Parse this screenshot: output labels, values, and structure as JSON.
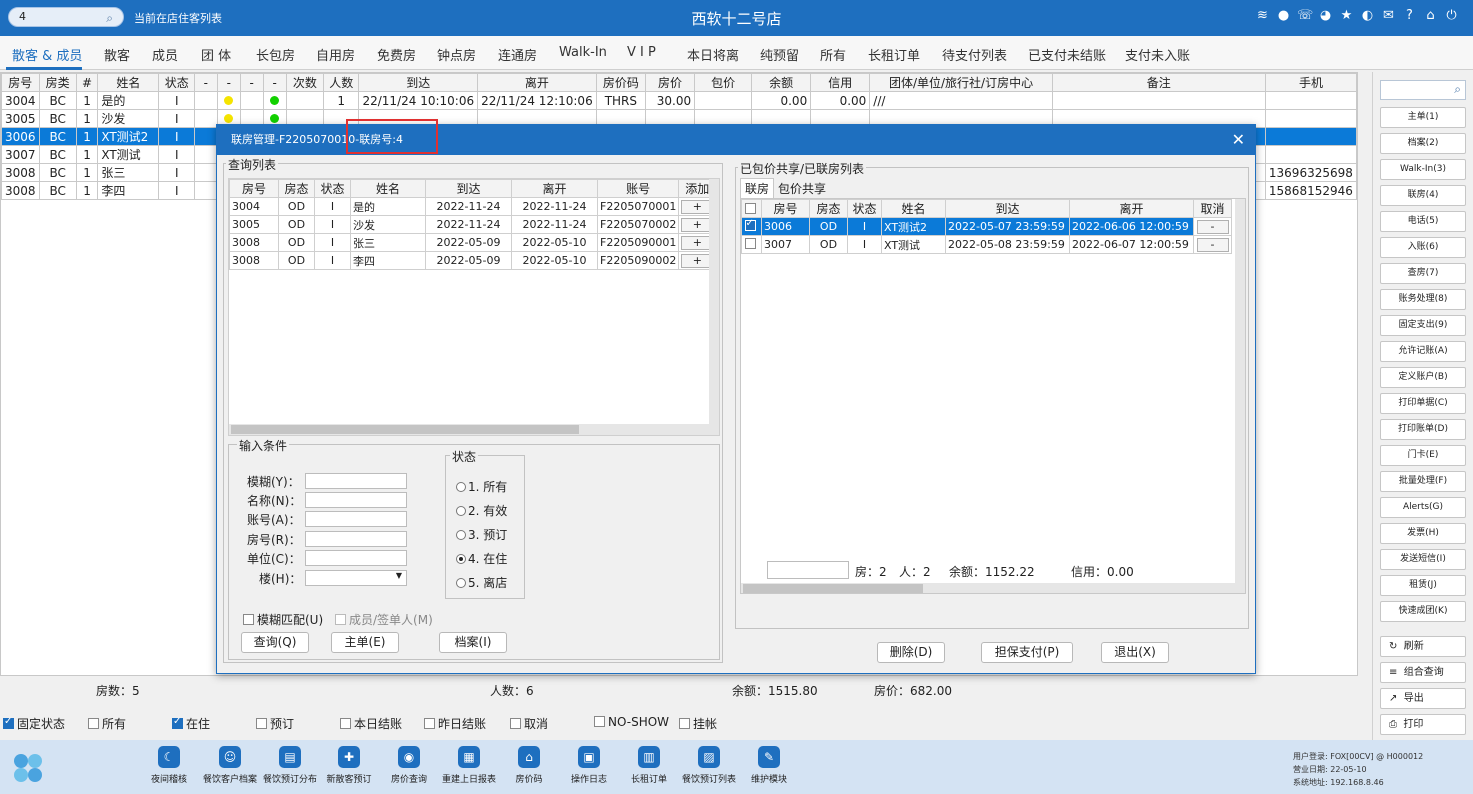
{
  "topbar": {
    "search_value": "4",
    "subtitle": "当前在店住客列表",
    "title": "西软十二号店",
    "icons": [
      "wifi-icon",
      "chat-icon",
      "phone-icon",
      "palette-icon",
      "star-icon",
      "moon-icon",
      "mail-icon",
      "help-icon",
      "home-icon",
      "power-icon"
    ]
  },
  "tabs": [
    "散客 & 成员",
    "散客",
    "成员",
    "团 体",
    "长包房",
    "自用房",
    "免费房",
    "钟点房",
    "连通房",
    "Walk-In",
    "V I P",
    "本日将离",
    "纯预留",
    "所有",
    "长租订单",
    "待支付列表",
    "已支付未结账",
    "支付未入账"
  ],
  "main_table": {
    "columns": [
      "房号",
      "房类",
      "#",
      "姓名",
      "状态",
      "-",
      "-",
      "-",
      "-",
      "次数",
      "人数",
      "到达",
      "离开",
      "房价码",
      "房价",
      "包价",
      "余额",
      "信用",
      "团体/单位/旅行社/订房中心",
      "备注",
      "手机"
    ],
    "rows": [
      {
        "room": "3004",
        "type": "BC",
        "n": "1",
        "name": "是的",
        "status": "I",
        "dot1": "yellow",
        "dot2": "green",
        "count": "",
        "persons": "1",
        "arrive": "22/11/24 10:10:06",
        "depart": "22/11/24 12:10:06",
        "rate_code": "THRS",
        "rate": "30.00",
        "pkg": "",
        "balance": "0.00",
        "credit": "0.00",
        "group": "///",
        "note": "",
        "mobile": ""
      },
      {
        "room": "3005",
        "type": "BC",
        "n": "1",
        "name": "沙发",
        "status": "I",
        "dot1": "yellow",
        "dot2": "green",
        "count": "",
        "persons": "",
        "arrive": "",
        "depart": "",
        "rate_code": "",
        "rate": "",
        "pkg": "",
        "balance": "",
        "credit": "",
        "group": "",
        "note": "",
        "mobile": ""
      },
      {
        "room": "3006",
        "type": "BC",
        "n": "1",
        "name": "XT测试2",
        "status": "I",
        "dot1": "",
        "dot2": "",
        "count": "",
        "persons": "",
        "arrive": "",
        "depart": "",
        "rate_code": "",
        "rate": "",
        "pkg": "",
        "balance": "",
        "credit": "",
        "group": "",
        "note": "",
        "mobile": ""
      },
      {
        "room": "3007",
        "type": "BC",
        "n": "1",
        "name": "XT测试",
        "status": "I",
        "dot1": "",
        "dot2": "",
        "count": "",
        "persons": "",
        "arrive": "",
        "depart": "",
        "rate_code": "",
        "rate": "",
        "pkg": "",
        "balance": "",
        "credit": "",
        "group": "",
        "note": "",
        "mobile": ""
      },
      {
        "room": "3008",
        "type": "BC",
        "n": "1",
        "name": "张三",
        "status": "I",
        "dot1": "",
        "dot2": "",
        "count": "",
        "persons": "",
        "arrive": "",
        "depart": "",
        "rate_code": "",
        "rate": "",
        "pkg": "",
        "balance": "",
        "credit": "",
        "group": "",
        "note": "",
        "mobile": "13696325698"
      },
      {
        "room": "3008",
        "type": "BC",
        "n": "1",
        "name": "李四",
        "status": "I",
        "dot1": "",
        "dot2": "",
        "count": "",
        "persons": "",
        "arrive": "",
        "depart": "",
        "rate_code": "",
        "rate": "",
        "pkg": "",
        "balance": "",
        "credit": "",
        "group": "",
        "note": "",
        "mobile": "15868152946"
      }
    ]
  },
  "main_footer": {
    "rooms": "房数：5",
    "persons": "人数：6",
    "balance": "余额：1515.80",
    "rate": "房价：682.00"
  },
  "filters": [
    {
      "label": "固定状态",
      "checked": true
    },
    {
      "label": "所有",
      "checked": false
    },
    {
      "label": "在住",
      "checked": true
    },
    {
      "label": "预订",
      "checked": false
    },
    {
      "label": "本日结账",
      "checked": false
    },
    {
      "label": "昨日结账",
      "checked": false
    },
    {
      "label": "取消",
      "checked": false
    },
    {
      "label": "NO-SHOW",
      "checked": false
    },
    {
      "label": "挂帐",
      "checked": false
    }
  ],
  "right_panel": {
    "buttons": [
      "主单(1)",
      "档案(2)",
      "Walk-In(3)",
      "联房(4)",
      "电话(5)",
      "入账(6)",
      "查房(7)",
      "账务处理(8)",
      "固定支出(9)",
      "允许记账(A)",
      "定义账户(B)",
      "打印单据(C)",
      "打印账单(D)",
      "门卡(E)",
      "批量处理(F)",
      "Alerts(G)",
      "发票(H)",
      "发送短信(I)",
      "租赁(J)",
      "快速成团(K)"
    ],
    "actions": [
      {
        "icon": "refresh-icon",
        "glyph": "↻",
        "label": "刷新"
      },
      {
        "icon": "list-icon",
        "glyph": "≡",
        "label": "组合查询"
      },
      {
        "icon": "export-icon",
        "glyph": "↗",
        "label": "导出"
      },
      {
        "icon": "print-icon",
        "glyph": "⎙",
        "label": "打印"
      }
    ]
  },
  "bottombar": {
    "items": [
      {
        "icon": "moon-icon",
        "glyph": "☾",
        "label": "夜间稽核"
      },
      {
        "icon": "user-icon",
        "glyph": "☺",
        "label": "餐饮客户档案"
      },
      {
        "icon": "chart-icon",
        "glyph": "▤",
        "label": "餐饮预订分布"
      },
      {
        "icon": "user-add-icon",
        "glyph": "✚",
        "label": "新散客预订"
      },
      {
        "icon": "database-icon",
        "glyph": "◉",
        "label": "房价查询"
      },
      {
        "icon": "report-icon",
        "glyph": "▦",
        "label": "重建上日报表"
      },
      {
        "icon": "home-icon",
        "glyph": "⌂",
        "label": "房价码"
      },
      {
        "icon": "calendar-icon",
        "glyph": "▣",
        "label": "操作日志"
      },
      {
        "icon": "map-icon",
        "glyph": "▥",
        "label": "长租订单"
      },
      {
        "icon": "clipboard-icon",
        "glyph": "▨",
        "label": "餐饮预订列表"
      },
      {
        "icon": "wrench-icon",
        "glyph": "✎",
        "label": "维护模块"
      }
    ],
    "sysinfo": [
      "用户登录:  FOX[00CV] @ H000012",
      "营业日期:  22-05-10",
      "系统地址:  192.168.8.46"
    ]
  },
  "dialog": {
    "title_prefix": "联房管理-F2205070010-",
    "title_highlight": "联房号:4",
    "query_group": "查询列表",
    "query_columns": [
      "房号",
      "房态",
      "状态",
      "姓名",
      "到达",
      "离开",
      "账号",
      "添加"
    ],
    "query_rows": [
      {
        "room": "3004",
        "rs": "OD",
        "st": "I",
        "name": "是的",
        "arrive": "2022-11-24",
        "depart": "2022-11-24",
        "acct": "F2205070001",
        "add": "+"
      },
      {
        "room": "3005",
        "rs": "OD",
        "st": "I",
        "name": "沙发",
        "arrive": "2022-11-24",
        "depart": "2022-11-24",
        "acct": "F2205070002",
        "add": "+"
      },
      {
        "room": "3008",
        "rs": "OD",
        "st": "I",
        "name": "张三",
        "arrive": "2022-05-09",
        "depart": "2022-05-10",
        "acct": "F2205090001",
        "add": "+"
      },
      {
        "room": "3008",
        "rs": "OD",
        "st": "I",
        "name": "李四",
        "arrive": "2022-05-09",
        "depart": "2022-05-10",
        "acct": "F2205090002",
        "add": "+"
      }
    ],
    "input_group": "输入条件",
    "fields": [
      "模糊(Y)：",
      "名称(N)：",
      "账号(A)：",
      "房号(R)：",
      "单位(C)：",
      "楼(H)："
    ],
    "status_group": "状态",
    "status_options": [
      {
        "label": "1. 所有",
        "selected": false
      },
      {
        "label": "2. 有效",
        "selected": false
      },
      {
        "label": "3. 预订",
        "selected": false
      },
      {
        "label": "4. 在住",
        "selected": true
      },
      {
        "label": "5. 离店",
        "selected": false
      }
    ],
    "fuzzy_match": "模糊匹配(U)",
    "member_signer": "成员/签单人(M)",
    "btn_query": "查询(Q)",
    "btn_master": "主单(E)",
    "btn_profile": "档案(I)",
    "linked_group": "已包价共享/已联房列表",
    "subtabs": [
      "联房",
      "包价共享"
    ],
    "linked_columns": [
      "",
      "房号",
      "房态",
      "状态",
      "姓名",
      "到达",
      "离开",
      "取消"
    ],
    "linked_rows": [
      {
        "checked": true,
        "room": "3006",
        "rs": "OD",
        "st": "I",
        "name": "XT测试2",
        "arrive": "2022-05-07 23:59:59",
        "depart": "2022-06-06 12:00:59",
        "cancel": "-"
      },
      {
        "checked": false,
        "room": "3007",
        "rs": "OD",
        "st": "I",
        "name": "XT测试",
        "arrive": "2022-05-08 23:59:59",
        "depart": "2022-06-07 12:00:59",
        "cancel": "-"
      }
    ],
    "linked_summary": {
      "rooms": "房：2",
      "persons": "人：2",
      "balance": "余额：1152.22",
      "credit": "信用：0.00"
    },
    "btn_delete": "删除(D)",
    "btn_guarantee": "担保支付(P)",
    "btn_exit": "退出(X)"
  }
}
